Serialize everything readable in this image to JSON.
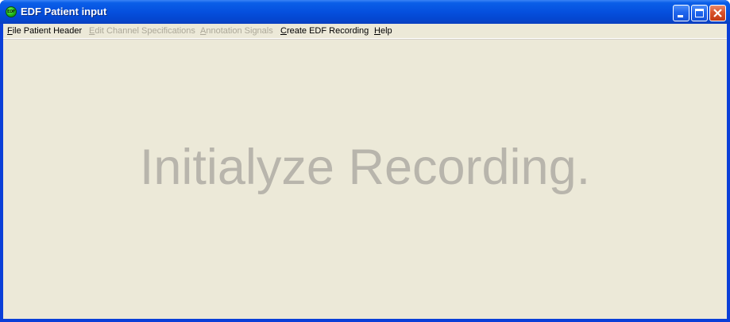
{
  "window": {
    "title": "EDF Patient input",
    "icon_label": "EDF",
    "icon": "edf-app-icon",
    "title_color": "#0550de",
    "client_bg": "#ece9d8"
  },
  "menubar": {
    "items": [
      {
        "mnemonic": "F",
        "rest": "ile Patient Header",
        "enabled": true
      },
      {
        "mnemonic": "E",
        "rest": "dit Channel Specifications",
        "enabled": false
      },
      {
        "mnemonic": "A",
        "rest": "nnotation Signals",
        "enabled": false
      },
      {
        "mnemonic": "C",
        "rest": "reate EDF Recording",
        "enabled": true
      },
      {
        "mnemonic": "H",
        "rest": "elp",
        "enabled": true
      }
    ]
  },
  "main": {
    "placeholder_text": "Initialyze Recording.",
    "placeholder_color": "#b8b5ac"
  },
  "controls": {
    "minimize_icon": "minimize-icon",
    "maximize_icon": "maximize-icon",
    "close_icon": "close-icon"
  }
}
